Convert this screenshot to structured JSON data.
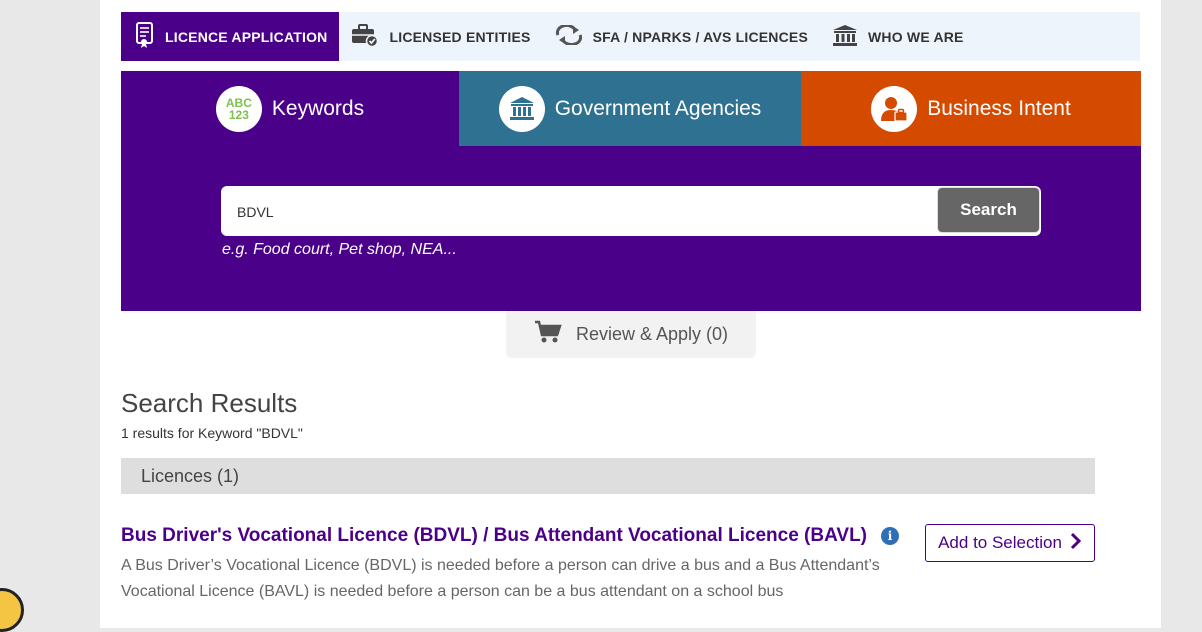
{
  "topnav": {
    "items": [
      {
        "label": "LICENCE APPLICATION",
        "icon": "certificate-icon",
        "active": true
      },
      {
        "label": "LICENSED ENTITIES",
        "icon": "briefcase-check-icon",
        "active": false
      },
      {
        "label": "SFA / NPARKS / AVS LICENCES",
        "icon": "refresh-arrows-icon",
        "active": false
      },
      {
        "label": "WHO WE ARE",
        "icon": "institution-icon",
        "active": false
      }
    ]
  },
  "search_tabs": {
    "keywords": {
      "label": "Keywords",
      "icon_text_top": "ABC",
      "icon_text_bottom": "123"
    },
    "agencies": {
      "label": "Government Agencies",
      "icon": "building-icon"
    },
    "intent": {
      "label": "Business Intent",
      "icon": "businessman-icon"
    }
  },
  "search": {
    "value": "BDVL",
    "button_label": "Search",
    "hint": "e.g. Food court, Pet shop, NEA..."
  },
  "review": {
    "label": "Review & Apply (0)",
    "icon": "cart-icon"
  },
  "results": {
    "title": "Search Results",
    "subtitle": "1 results for Keyword \"BDVL\"",
    "group_label": "Licences (1)",
    "items": [
      {
        "title": "Bus Driver's Vocational Licence (BDVL) / Bus Attendant Vocational Licence (BAVL)",
        "description": "A Bus Driver’s Vocational Licence (BDVL) is needed before a person can drive a bus and a Bus Attendant’s Vocational Licence (BAVL) is needed before a person can be a bus attendant on a school bus",
        "add_label": "Add to Selection"
      }
    ]
  },
  "colors": {
    "purple": "#4b0089",
    "teal": "#2e7190",
    "orange": "#d44b00",
    "nav_bg": "#eef4fb"
  }
}
